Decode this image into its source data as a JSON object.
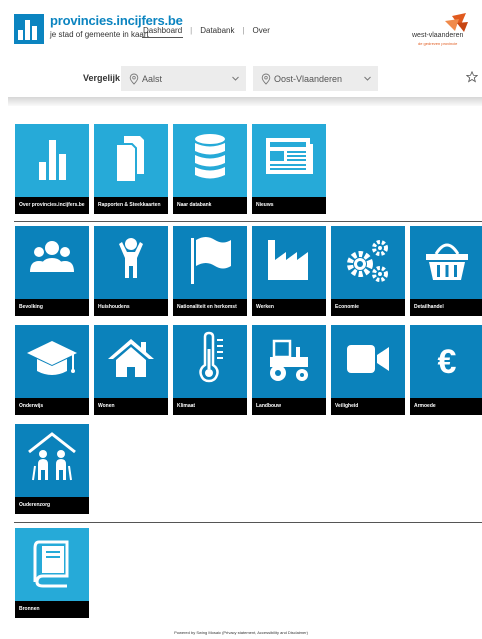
{
  "header": {
    "logo_title": "provincies.incijfers.be",
    "logo_subtitle": "je stad of gemeente in kaart",
    "nav": [
      {
        "label": "Dashboard",
        "active": true
      },
      {
        "label": "Databank",
        "active": false
      },
      {
        "label": "Over",
        "active": false
      }
    ],
    "partner_logo": "west-vlaanderen",
    "partner_tagline": "de gedreven provincie"
  },
  "compare": {
    "label": "Vergelijk",
    "select_municipality": "Aalst",
    "select_province": "Oost-Vlaanderen",
    "favorite_icon": "star-icon"
  },
  "sections": [
    {
      "tiles": [
        {
          "label": "Over provincies.incijfers.be",
          "icon": "bar-chart-icon"
        },
        {
          "label": "Rapporten & Steekkaarten",
          "icon": "documents-icon"
        },
        {
          "label": "Naar databank",
          "icon": "database-icon"
        },
        {
          "label": "Nieuws",
          "icon": "newspaper-icon"
        }
      ]
    },
    {
      "tiles": [
        {
          "label": "Bevolking",
          "icon": "people-icon"
        },
        {
          "label": "Huishoudens",
          "icon": "person-icon"
        },
        {
          "label": "Nationaliteit en herkomst",
          "icon": "flag-icon"
        },
        {
          "label": "Werken",
          "icon": "factory-icon"
        },
        {
          "label": "Economie",
          "icon": "gears-icon"
        },
        {
          "label": "Detailhandel",
          "icon": "basket-icon"
        },
        {
          "label": "Onderwijs",
          "icon": "graduation-cap-icon"
        },
        {
          "label": "Wonen",
          "icon": "house-icon"
        },
        {
          "label": "Klimaat",
          "icon": "thermometer-icon"
        },
        {
          "label": "Landbouw",
          "icon": "tractor-icon"
        },
        {
          "label": "Veiligheid",
          "icon": "camera-icon"
        },
        {
          "label": "Armoede",
          "icon": "euro-icon"
        },
        {
          "label": "Ouderenzorg",
          "icon": "elderly-care-icon"
        }
      ]
    },
    {
      "tiles": [
        {
          "label": "Bronnen",
          "icon": "book-icon"
        }
      ]
    }
  ],
  "footer": {
    "text": "Powered by Swing Mosaic (Privacy statement, Accessibility and Disclaimer)"
  },
  "colors": {
    "brand_blue": "#0b84c0",
    "tile_light": "#26aad8",
    "tile_dark": "#0b82bb",
    "caption_bg": "#000000",
    "partner_orange": "#e05a1e"
  }
}
